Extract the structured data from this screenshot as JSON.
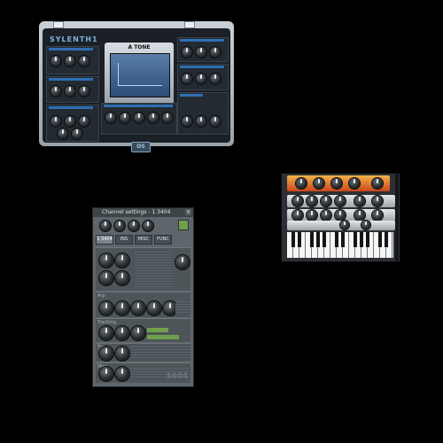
{
  "synth1": {
    "logo": "SYLENTH1",
    "screen_title": "A TONE",
    "badge": "OS"
  },
  "synth2": {
    "name_icon": "rack-synth-with-keyboard"
  },
  "channel_settings": {
    "title": "Channel settings - 1 3404",
    "tabs": [
      "1 3404",
      "INS",
      "MISC",
      "FUNC"
    ],
    "active_tab": 0,
    "section_labels": [
      "",
      "Arp",
      "Tracking",
      "Time",
      "Env",
      "Misc"
    ],
    "watermark": "3404"
  },
  "colors": {
    "background": "#000000",
    "accent_blue": "#2f6fb3",
    "panel_gray": "#5e666b",
    "active_green": "#6fa14d",
    "orange": "#e3762f"
  }
}
